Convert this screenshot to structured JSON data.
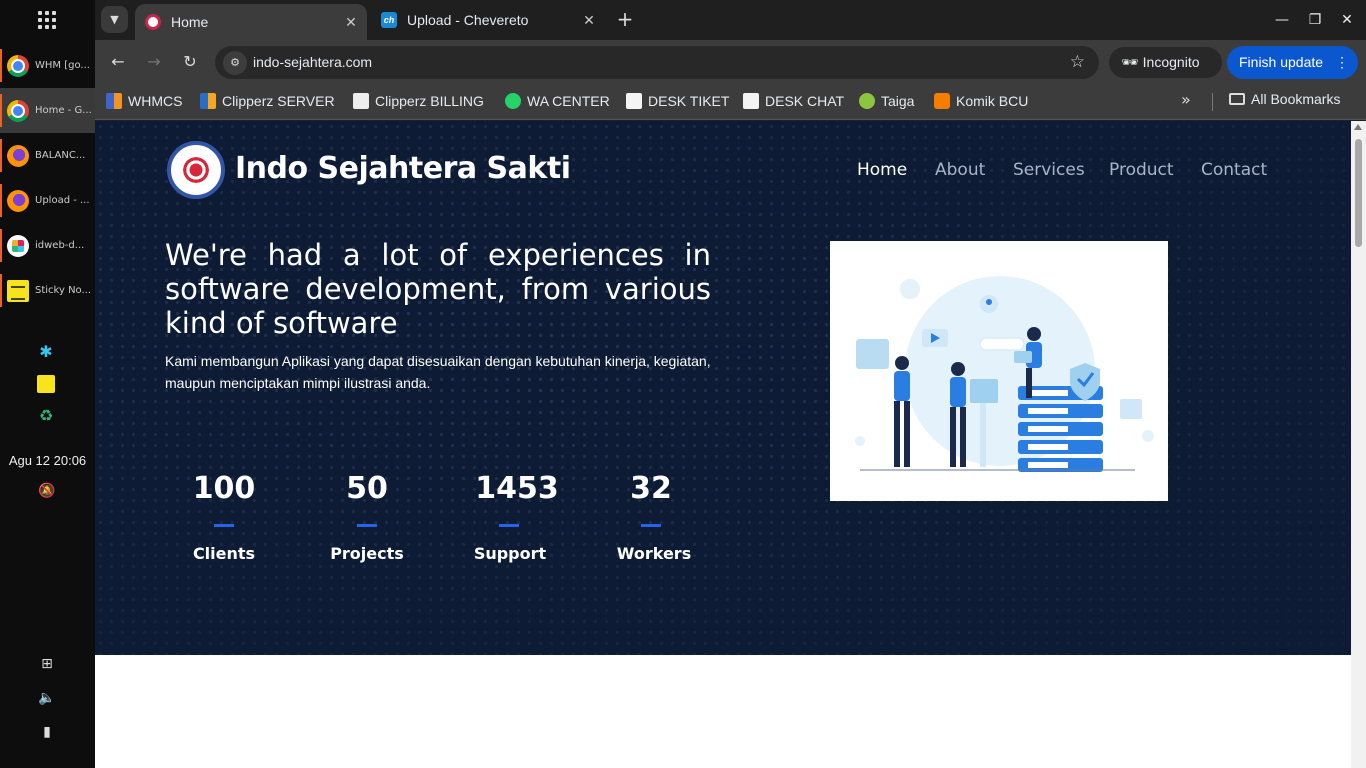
{
  "taskbar": {
    "tasks": [
      {
        "label": "WHM [go...",
        "icon": "chrome-icon"
      },
      {
        "label": "Home - G...",
        "icon": "chrome-icon"
      },
      {
        "label": "BALANC...",
        "icon": "firefox-icon"
      },
      {
        "label": "Upload - ...",
        "icon": "firefox-icon"
      },
      {
        "label": "idweb-d...",
        "icon": "slack-icon"
      },
      {
        "label": "Sticky No...",
        "icon": "sticky-notes-icon"
      }
    ],
    "clock": "Agu 12  20:06"
  },
  "browser": {
    "tabs": [
      {
        "title": "Home",
        "active": true
      },
      {
        "title": "Upload - Chevereto",
        "active": false
      }
    ],
    "url": "indo-sejahtera.com",
    "incognito_label": "Incognito",
    "finish_update_label": "Finish update",
    "bookmarks": [
      {
        "label": "WHMCS"
      },
      {
        "label": "Clipperz SERVER"
      },
      {
        "label": "Clipperz BILLING"
      },
      {
        "label": "WA CENTER"
      },
      {
        "label": "DESK TIKET"
      },
      {
        "label": "DESK CHAT"
      },
      {
        "label": "Taiga"
      },
      {
        "label": "Komik BCU"
      }
    ],
    "all_bookmarks_label": "All Bookmarks"
  },
  "page": {
    "brand": "Indo Sejahtera Sakti",
    "nav": [
      "Home",
      "About",
      "Services",
      "Product",
      "Contact"
    ],
    "headline": "We're had a lot of experiences in software development, from various kind of software",
    "subtext": "Kami membangun Aplikasi yang dapat disesuaikan dengan kebutuhan kinerja, kegiatan, maupun menciptakan mimpi ilustrasi anda.",
    "stats": [
      {
        "value": "100",
        "label": "Clients"
      },
      {
        "value": "50",
        "label": "Projects"
      },
      {
        "value": "1453",
        "label": "Support"
      },
      {
        "value": "32",
        "label": "Workers"
      }
    ],
    "colors": {
      "hero_bg": "#0d1b35",
      "accent": "#2563eb"
    }
  }
}
